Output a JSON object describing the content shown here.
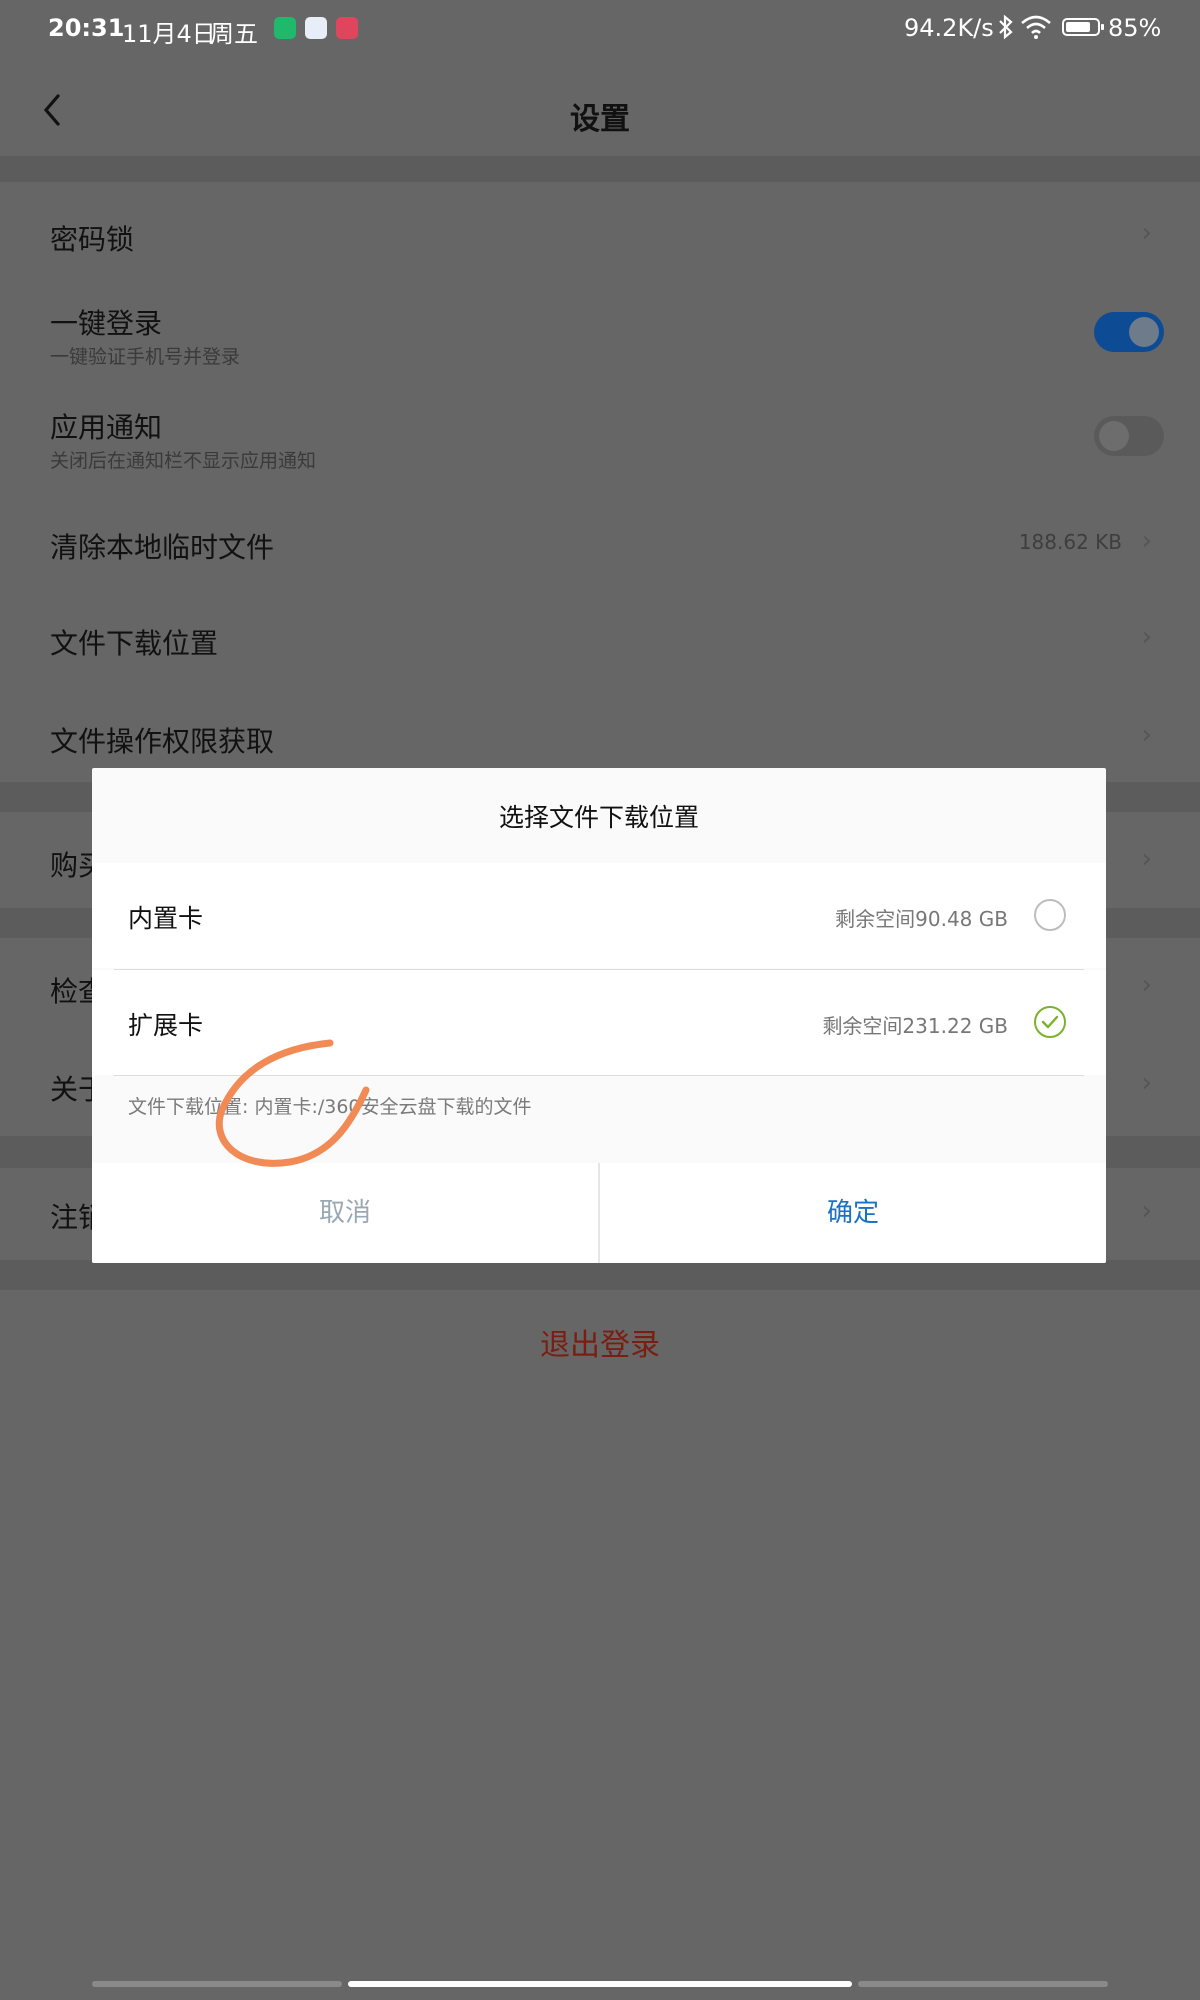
{
  "status_bar": {
    "time": "20:31",
    "date": "11月4日",
    "weekday": "周五",
    "network_speed": "94.2K/s",
    "battery_percent": "85%",
    "battery_level": 0.85,
    "app_icons": [
      "green-app-icon",
      "baidu-netdisk-icon",
      "pink-app-icon"
    ]
  },
  "header": {
    "title": "设置"
  },
  "settings": {
    "password_lock": "密码锁",
    "one_click_login": {
      "label": "一键登录",
      "sub": "一键验证手机号并登录",
      "on": true
    },
    "app_notification": {
      "label": "应用通知",
      "sub": "关闭后在通知栏不显示应用通知",
      "on": false
    },
    "clear_temp": {
      "label": "清除本地临时文件",
      "value": "188.62 KB"
    },
    "download_location": "文件下载位置",
    "file_permission": "文件操作权限获取",
    "purchase_partial": "购买",
    "check_partial": "检查",
    "about_partial": "关于",
    "cancel_account_partial": "注销",
    "logout": "退出登录"
  },
  "dialog": {
    "title": "选择文件下载位置",
    "options": [
      {
        "name": "内置卡",
        "space": "剩余空间90.48 GB",
        "selected": false
      },
      {
        "name": "扩展卡",
        "space": "剩余空间231.22 GB",
        "selected": true
      }
    ],
    "path_text": "文件下载位置: 内置卡:/360安全云盘下载的文件",
    "cancel_label": "取消",
    "ok_label": "确定"
  },
  "colors": {
    "overlay_bg": "#666666",
    "toggle_on": "#0d4b95",
    "confirm_blue": "#1a73c2",
    "logout_red": "#7a1e12",
    "check_green": "#7ab12d",
    "scribble_orange": "#f28a55"
  }
}
